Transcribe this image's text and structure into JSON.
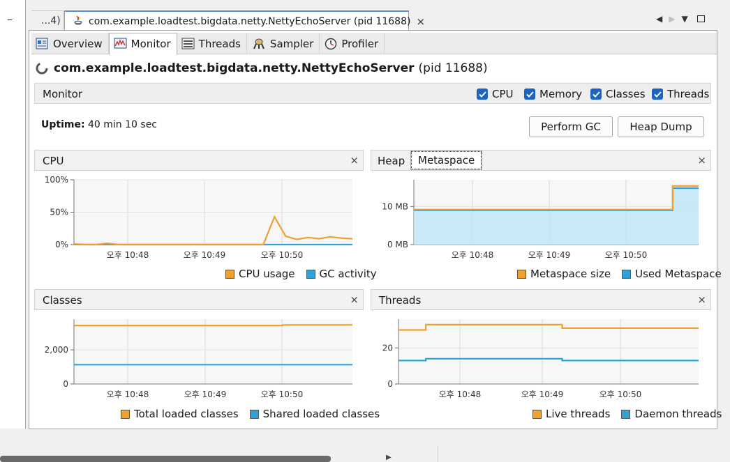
{
  "left": {
    "minimize_label": "–"
  },
  "tabs": {
    "prev_label": "...4)",
    "active_label": "com.example.loadtest.bigdata.netty.NettyEchoServer (pid 11688)",
    "close": "×"
  },
  "subtabs": [
    {
      "label": "Overview",
      "icon": "overview-icon"
    },
    {
      "label": "Monitor",
      "icon": "monitor-icon"
    },
    {
      "label": "Threads",
      "icon": "threads-icon"
    },
    {
      "label": "Sampler",
      "icon": "sampler-icon"
    },
    {
      "label": "Profiler",
      "icon": "profiler-icon"
    }
  ],
  "process": {
    "name": "com.example.loadtest.bigdata.netty.NettyEchoServer",
    "pid": "(pid 11688)"
  },
  "monitor": {
    "title": "Monitor",
    "checkboxes": [
      {
        "label": "CPU",
        "checked": true
      },
      {
        "label": "Memory",
        "checked": true
      },
      {
        "label": "Classes",
        "checked": true
      },
      {
        "label": "Threads",
        "checked": true
      }
    ],
    "uptime_label": "Uptime:",
    "uptime_value": "40 min 10 sec",
    "perform_gc": "Perform GC",
    "heap_dump": "Heap Dump"
  },
  "panels": {
    "cpu": {
      "title": "CPU",
      "close": "×"
    },
    "heap": {
      "tab_heap": "Heap",
      "tab_meta": "Metaspace",
      "close": "×"
    },
    "classes": {
      "title": "Classes",
      "close": "×"
    },
    "threads": {
      "title": "Threads",
      "close": "×"
    }
  },
  "colors": {
    "orange": "#f0a030",
    "blue": "#2fa3d6",
    "accent": "#1a63c0"
  },
  "chart_data": [
    {
      "type": "line",
      "title": "CPU",
      "x_ticks": [
        "오후 10:48",
        "오후 10:49",
        "오후 10:50"
      ],
      "y_ticks": [
        "100%",
        "50%",
        "0%"
      ],
      "ylim": [
        0,
        100
      ],
      "series": [
        {
          "name": "CPU usage",
          "values": [
            1,
            0,
            0,
            2,
            0,
            0,
            0,
            0,
            0,
            0,
            0,
            0,
            0,
            0,
            0,
            0,
            0,
            0,
            43,
            13,
            8,
            11,
            9,
            12,
            10,
            9
          ]
        },
        {
          "name": "GC activity",
          "values": [
            0,
            0,
            0,
            0,
            0,
            0,
            0,
            0,
            0,
            0,
            0,
            0,
            0,
            0,
            0,
            0,
            0,
            0,
            0,
            0,
            0,
            0,
            0,
            0,
            0,
            0
          ]
        }
      ]
    },
    {
      "type": "area",
      "title": "Metaspace",
      "x_ticks": [
        "오후 10:48",
        "오후 10:49",
        "오후 10:50"
      ],
      "y_ticks": [
        "10 MB",
        "0 MB"
      ],
      "ylim": [
        0,
        17
      ],
      "series": [
        {
          "name": "Metaspace size",
          "values": [
            9.2,
            9.2,
            9.2,
            9.2,
            9.2,
            9.2,
            9.2,
            9.2,
            9.2,
            9.2,
            15.4,
            15.4
          ]
        },
        {
          "name": "Used Metaspace",
          "values": [
            9.0,
            9.0,
            9.0,
            9.0,
            9.0,
            9.0,
            9.0,
            9.0,
            9.0,
            9.0,
            14.8,
            14.8
          ]
        }
      ]
    },
    {
      "type": "line",
      "title": "Classes",
      "x_ticks": [
        "오후 10:48",
        "오후 10:49",
        "오후 10:50"
      ],
      "y_ticks": [
        "2,000",
        "0"
      ],
      "ylim": [
        0,
        3800
      ],
      "series": [
        {
          "name": "Total loaded classes",
          "values": [
            3430,
            3430,
            3430,
            3430,
            3430,
            3430,
            3460,
            3460,
            3460
          ]
        },
        {
          "name": "Shared loaded classes",
          "values": [
            1130,
            1130,
            1130,
            1130,
            1130,
            1130,
            1130,
            1130,
            1130
          ]
        }
      ]
    },
    {
      "type": "line",
      "title": "Threads",
      "x_ticks": [
        "오후 10:48",
        "오후 10:49",
        "오후 10:50"
      ],
      "y_ticks": [
        "20",
        "0"
      ],
      "ylim": [
        0,
        36
      ],
      "series": [
        {
          "name": "Live threads",
          "values": [
            30,
            33,
            33,
            33,
            33,
            33,
            31,
            31,
            31,
            31,
            31,
            31
          ]
        },
        {
          "name": "Daemon threads",
          "values": [
            13,
            14,
            14,
            14,
            14,
            14,
            13,
            13,
            13,
            13,
            13,
            13
          ]
        }
      ]
    }
  ]
}
